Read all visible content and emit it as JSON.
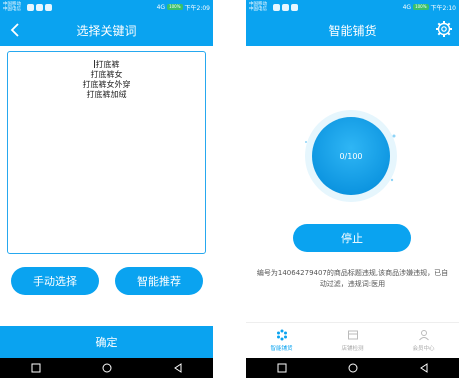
{
  "left_screen": {
    "status": {
      "carrier": "中国移动 中国电信",
      "battery": "100%",
      "time": "下午2:09",
      "signal": "4G"
    },
    "title": "选择关键词",
    "keywords": [
      "打底裤",
      "打底裤女",
      "打底裤女外穿",
      "打底裤加绒"
    ],
    "buttons": {
      "manual": "手动选择",
      "smart": "智能推荐",
      "confirm": "确定"
    }
  },
  "right_screen": {
    "status": {
      "carrier": "中国移动 中国电信",
      "battery": "100%",
      "time": "下午2:10",
      "signal": "4G"
    },
    "title": "智能铺货",
    "progress": {
      "done": 0,
      "total": 100,
      "text": "0/100"
    },
    "buttons": {
      "stop": "停止"
    },
    "notice": "编号为14064279407的商品标题违规,该商品涉嫌违规，已自动过滤，违规词:医用",
    "tabs": [
      {
        "label": "智能铺货",
        "icon": "snowflake-icon",
        "active": true
      },
      {
        "label": "店铺检测",
        "icon": "store-icon",
        "active": false
      },
      {
        "label": "会员中心",
        "icon": "user-icon",
        "active": false
      }
    ]
  },
  "colors": {
    "primary": "#0aa3f0",
    "white": "#ffffff",
    "navbar": "#000000"
  }
}
